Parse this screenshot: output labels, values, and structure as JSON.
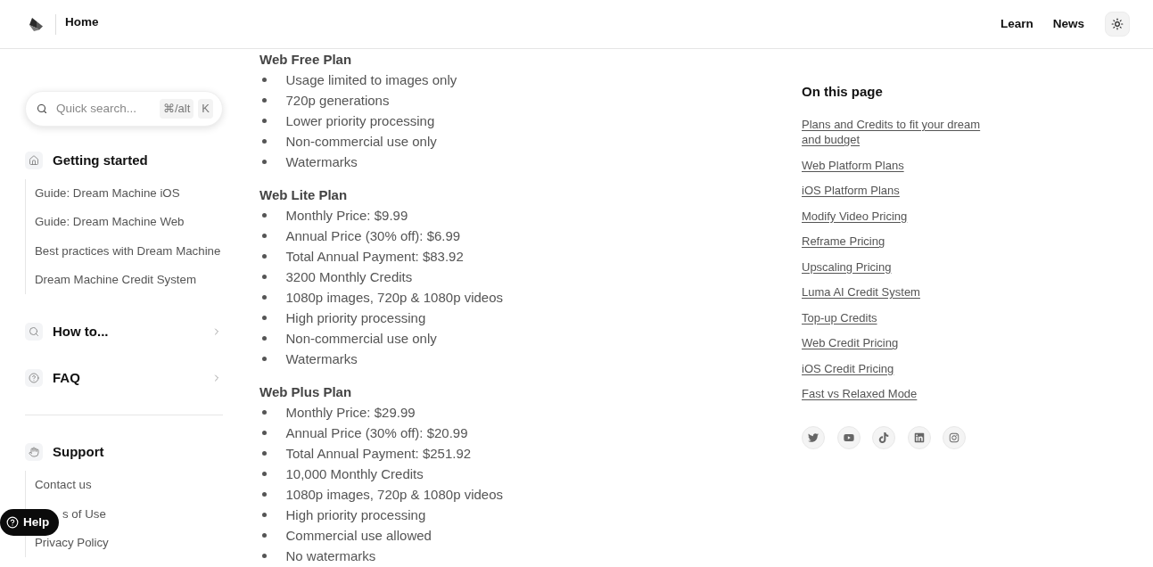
{
  "header": {
    "title": "Home",
    "nav": [
      {
        "label": "Learn"
      },
      {
        "label": "News"
      }
    ]
  },
  "sidebar": {
    "search": {
      "placeholder": "Quick search...",
      "keys": [
        "⌘/alt",
        "K"
      ]
    },
    "groups": [
      {
        "sections": [
          {
            "label": "Getting started",
            "expanded": true,
            "items": [
              {
                "label": "Guide: Dream Machine iOS",
                "kind": "link"
              },
              {
                "label": "Guide: Dream Machine Web",
                "kind": "link"
              },
              {
                "label": "Best practices with Dream Machine",
                "kind": "link"
              },
              {
                "label": "Dream Machine Credit System",
                "kind": "link"
              }
            ]
          },
          {
            "label": "How to...",
            "expanded": false
          },
          {
            "label": "FAQ",
            "expanded": false
          }
        ]
      },
      {
        "sections": [
          {
            "label": "Support",
            "expanded": true,
            "items": [
              {
                "label": "Contact us",
                "kind": "link"
              },
              {
                "label": "s of Use",
                "kind": "covered"
              },
              {
                "label": "Privacy Policy",
                "kind": "link"
              }
            ]
          }
        ]
      }
    ]
  },
  "content": {
    "plans": [
      {
        "title": "Web Free Plan",
        "features": [
          "Usage limited to images only",
          "720p generations",
          "Lower priority processing",
          "Non-commercial use only",
          "Watermarks"
        ]
      },
      {
        "title": "Web Lite Plan",
        "features": [
          "Monthly Price: $9.99",
          "Annual Price (30% off): $6.99",
          "Total Annual Payment: $83.92",
          "3200 Monthly Credits",
          "1080p images, 720p & 1080p videos",
          "High priority processing",
          "Non-commercial use only",
          "Watermarks"
        ]
      },
      {
        "title": "Web Plus Plan",
        "features": [
          "Monthly Price: $29.99",
          "Annual Price (30% off): $20.99",
          "Total Annual Payment: $251.92",
          "10,000 Monthly Credits",
          "1080p images, 720p & 1080p videos",
          "High priority processing",
          "Commercial use allowed",
          "No watermarks"
        ]
      }
    ]
  },
  "toc": {
    "title": "On this page",
    "links": [
      "Plans and Credits to fit your dream and budget",
      "Web Platform Plans",
      "iOS Platform Plans",
      "Modify Video Pricing",
      "Reframe Pricing",
      "Upscaling Pricing",
      "Luma AI Credit System",
      "Top-up Credits",
      "Web Credit Pricing",
      "iOS Credit Pricing",
      "Fast vs Relaxed Mode"
    ]
  },
  "help_button": {
    "label": "Help"
  }
}
